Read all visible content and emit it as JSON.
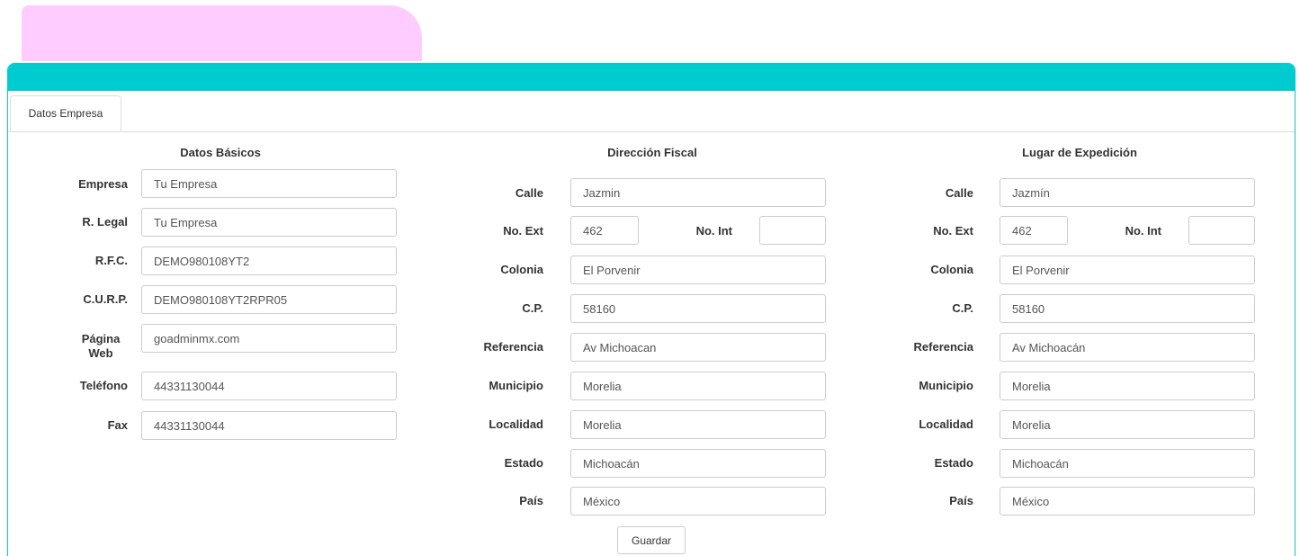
{
  "tab_label": "Datos Empresa",
  "basicos": {
    "title": "Datos Básicos",
    "empresa": {
      "label": "Empresa",
      "value": "Tu Empresa"
    },
    "rlegal": {
      "label": "R. Legal",
      "value": "Tu Empresa"
    },
    "rfc": {
      "label": "R.F.C.",
      "value": "DEMO980108YT2"
    },
    "curp": {
      "label": "C.U.R.P.",
      "value": "DEMO980108YT2RPR05"
    },
    "web": {
      "label1": "Página",
      "label2": "Web",
      "value": "goadminmx.com"
    },
    "telefono": {
      "label": "Teléfono",
      "value": "44331130044"
    },
    "fax": {
      "label": "Fax",
      "value": "44331130044"
    }
  },
  "fiscal": {
    "title": "Dirección Fiscal",
    "calle": {
      "label": "Calle",
      "value": "Jazmin"
    },
    "noext": {
      "label": "No. Ext",
      "value": "462"
    },
    "noint": {
      "label": "No. Int",
      "value": ""
    },
    "colonia": {
      "label": "Colonia",
      "value": "El Porvenir"
    },
    "cp": {
      "label": "C.P.",
      "value": "58160"
    },
    "referencia": {
      "label": "Referencia",
      "value": "Av Michoacan"
    },
    "municipio": {
      "label": "Municipio",
      "value": "Morelia"
    },
    "localidad": {
      "label": "Localidad",
      "value": "Morelia"
    },
    "estado": {
      "label": "Estado",
      "value": "Michoacán"
    },
    "pais": {
      "label": "País",
      "value": "México"
    }
  },
  "expedicion": {
    "title": "Lugar de Expedición",
    "calle": {
      "label": "Calle",
      "value": "Jazmín"
    },
    "noext": {
      "label": "No. Ext",
      "value": "462"
    },
    "noint": {
      "label": "No. Int",
      "value": ""
    },
    "colonia": {
      "label": "Colonia",
      "value": "El Porvenir"
    },
    "cp": {
      "label": "C.P.",
      "value": "58160"
    },
    "referencia": {
      "label": "Referencia",
      "value": "Av Michoacán"
    },
    "municipio": {
      "label": "Municipio",
      "value": "Morelia"
    },
    "localidad": {
      "label": "Localidad",
      "value": "Morelia"
    },
    "estado": {
      "label": "Estado",
      "value": "Michoacán"
    },
    "pais": {
      "label": "País",
      "value": "México"
    }
  },
  "save_label": "Guardar",
  "colors": {
    "accent": "#00ccd0",
    "brand_tab": "#ffccff"
  }
}
